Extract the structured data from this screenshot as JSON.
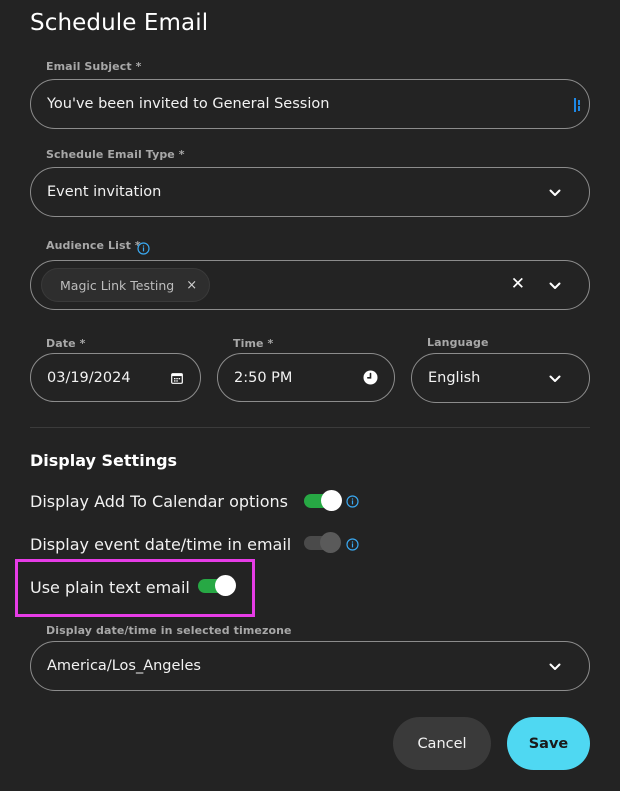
{
  "dialog": {
    "title": "Schedule Email"
  },
  "email_subject": {
    "label": "Email Subject *",
    "value": "You've been invited to General Session"
  },
  "schedule_email_type": {
    "label": "Schedule Email Type *",
    "value": "Event invitation"
  },
  "audience_list": {
    "label": "Audience List *",
    "chips": [
      "Magic Link Testing"
    ],
    "chip_remove": "×",
    "clear_symbol": "✕"
  },
  "date": {
    "label": "Date *",
    "value": "03/19/2024"
  },
  "time": {
    "label": "Time *",
    "value": "2:50 PM"
  },
  "language": {
    "label": "Language",
    "value": "English"
  },
  "display_settings": {
    "title": "Display Settings",
    "add_to_calendar": {
      "label": "Display Add To Calendar options",
      "enabled": true
    },
    "event_datetime": {
      "label": "Display event date/time in email",
      "enabled": false
    },
    "plain_text": {
      "label": "Use plain text email",
      "enabled": true
    }
  },
  "timezone": {
    "label": "Display date/time in selected timezone",
    "value": "America/Los_Angeles"
  },
  "actions": {
    "cancel_label": "Cancel",
    "save_label": "Save"
  },
  "colors": {
    "background": "#232323",
    "toggle_on": "#27a844",
    "save_button": "#4fd8f2",
    "highlight": "#e63ce6",
    "info_icon": "#3aa8f0"
  },
  "icons": {
    "subject_field": "tag-icon",
    "dropdown": "chevron-down-icon",
    "date": "calendar-icon",
    "time": "clock-icon",
    "info": "info-icon"
  }
}
